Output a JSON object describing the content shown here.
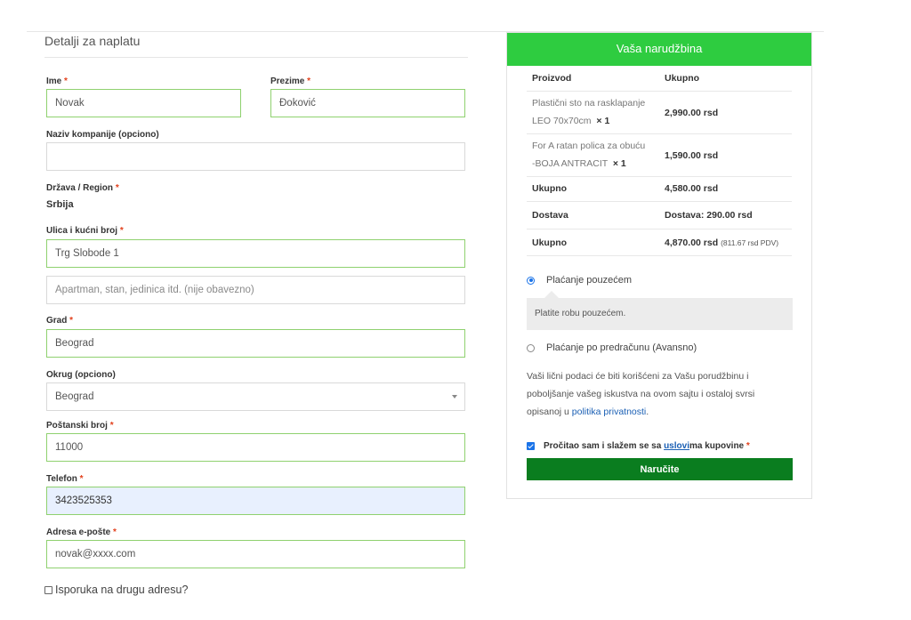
{
  "billing": {
    "title": "Detalji za naplatu",
    "first_name": {
      "label": "Ime",
      "value": "Novak"
    },
    "last_name": {
      "label": "Prezime",
      "value": "Đoković"
    },
    "company": {
      "label": "Naziv kompanije (opciono)",
      "value": ""
    },
    "country": {
      "label": "Država / Region",
      "value": "Srbija"
    },
    "street": {
      "label": "Ulica i kućni broj",
      "value": "Trg Slobode 1",
      "placeholder2": "Apartman, stan, jedinica itd. (nije obavezno)"
    },
    "city": {
      "label": "Grad",
      "value": "Beograd"
    },
    "district": {
      "label": "Okrug (opciono)",
      "value": "Beograd"
    },
    "postcode": {
      "label": "Poštanski broj",
      "value": "11000"
    },
    "phone": {
      "label": "Telefon",
      "value": "3423525353"
    },
    "email": {
      "label": "Adresa e-pošte",
      "value": "novak@xxxx.com"
    },
    "required_mark": "*",
    "ship_to_different": "Isporuka na drugu adresu?"
  },
  "order": {
    "title": "Vaša narudžbina",
    "col_product": "Proizvod",
    "col_total": "Ukupno",
    "items": [
      {
        "line1": "Plastični sto na rasklapanje",
        "line2": "LEO 70x70cm",
        "qty": "× 1",
        "price": "2,990.00 rsd"
      },
      {
        "line1": "For A ratan polica za obuću",
        "line2": "-BOJA ANTRACIT",
        "qty": "× 1",
        "price": "1,590.00 rsd"
      }
    ],
    "subtotal_label": "Ukupno",
    "subtotal_value": "4,580.00 rsd",
    "shipping_label": "Dostava",
    "shipping_value": "Dostava: 290.00 rsd",
    "total_label": "Ukupno",
    "total_value": "4,870.00 rsd",
    "total_vat": "(811.67 rsd PDV)",
    "payment_cod": "Plaćanje pouzećem",
    "payment_cod_desc": "Platite robu pouzećem.",
    "payment_advance": "Plaćanje po predračunu (Avansno)",
    "privacy_text": "Vaši lični podaci će biti korišćeni za Vašu porudžbinu i poboljšanje vašeg iskustva na ovom sajtu i ostaloj svrsi opisanoj u",
    "privacy_link": "politika privatnosti",
    "privacy_end": ".",
    "terms_prefix": "Pročitao sam i slažem se sa",
    "terms_link": "uslovi",
    "terms_suffix": "ma kupovine",
    "place_order": "Naručite"
  },
  "colors": {
    "accent_green": "#2ecc40",
    "button_green": "#0a7d1f",
    "field_border": "#8fd16f",
    "link_blue": "#1a5fb4"
  }
}
